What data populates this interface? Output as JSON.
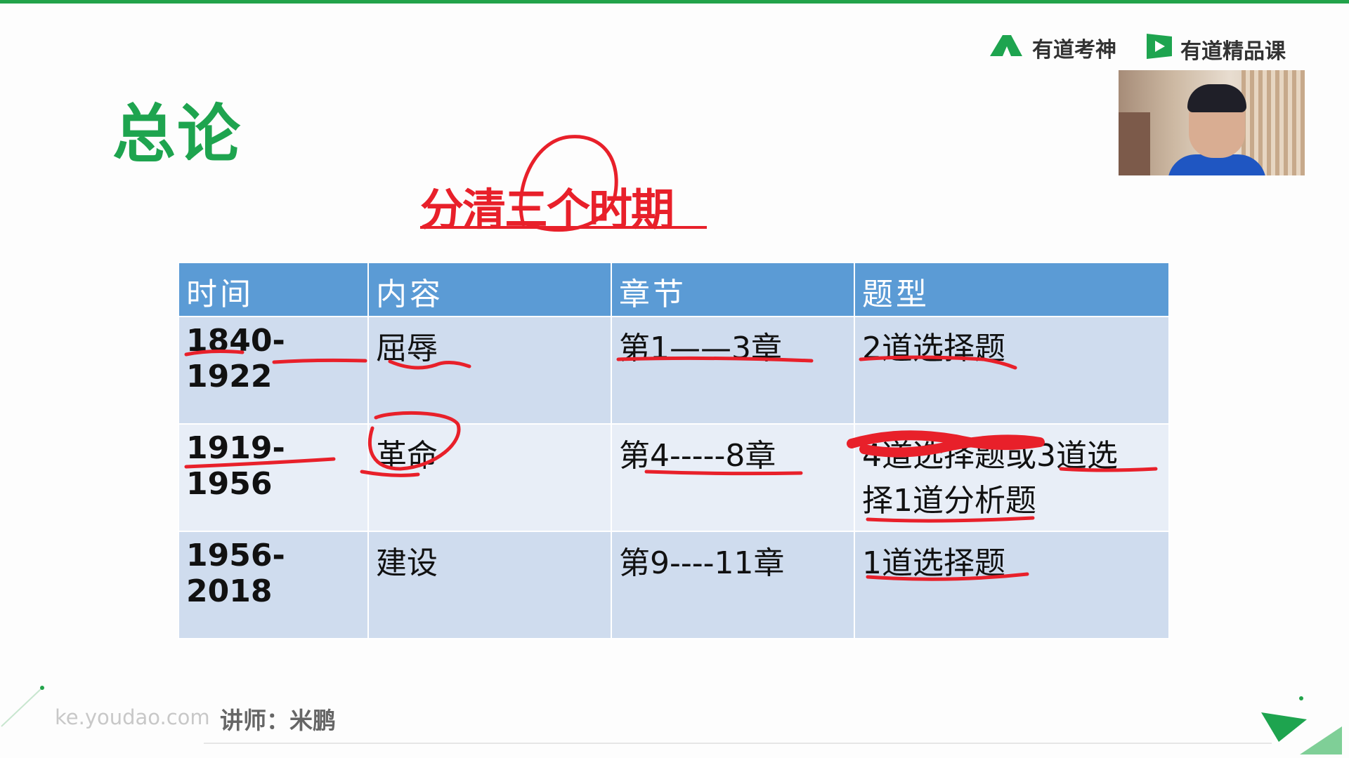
{
  "header": {
    "brand_kaoshen": "有道考神",
    "brand_course": "有道精品课"
  },
  "slide": {
    "title": "总论",
    "subtitle": "分清三个时期"
  },
  "table": {
    "headers": [
      "时间",
      "内容",
      "章节",
      "题型"
    ],
    "rows": [
      {
        "time": "1840-1922",
        "content": "屈辱",
        "chapter": "第1——3章",
        "type": "2道选择题"
      },
      {
        "time": "1919-1956",
        "content": "革命",
        "chapter": "第4-----8章",
        "type_line1": "4道选择题或3道选",
        "type_line2": "择1道分析题"
      },
      {
        "time": "1956-2018",
        "content": "建设",
        "chapter": "第9----11章",
        "type": "1道选择题"
      }
    ]
  },
  "footer": {
    "url": "ke.youdao.com",
    "teacher": "讲师：米鹏"
  },
  "colors": {
    "brand_green": "#1ea44f",
    "annotation_red": "#e8202a",
    "header_blue": "#5b9bd5"
  }
}
